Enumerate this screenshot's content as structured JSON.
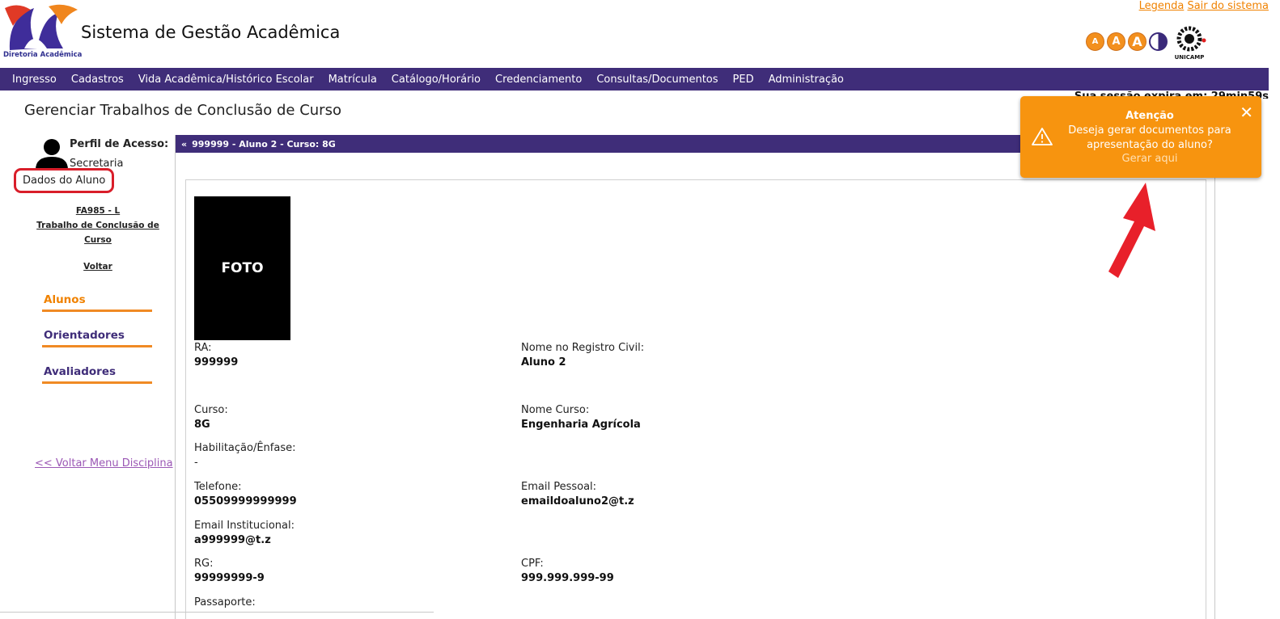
{
  "header": {
    "logo_caption": "Diretoria Acadêmica",
    "system_title": "Sistema de Gestão Acadêmica",
    "links": [
      "Legenda",
      "Sair do sistema"
    ],
    "accessibility": [
      "A",
      "A",
      "A"
    ],
    "unicamp_text": "UNICAMP"
  },
  "nav": {
    "items": [
      "Ingresso",
      "Cadastros",
      "Vida Acadêmica/Histórico Escolar",
      "Matrícula",
      "Catálogo/Horário",
      "Credenciamento",
      "Consultas/Documentos",
      "PED",
      "Administração"
    ]
  },
  "page": {
    "title": "Gerenciar Trabalhos de Conclusão de Curso",
    "partial_text": "Sua sessão expira em: 29min59s"
  },
  "sidebar": {
    "profile_label": "Perfil de Acesso:",
    "profile_value": "Secretaria",
    "course_code": "FA985 - L",
    "course_name_1": "Trabalho de Conclusão de",
    "course_name_2": "Curso",
    "back": "Voltar",
    "menu": [
      "Alunos",
      "Orientadores",
      "Avaliadores"
    ],
    "back_menu": "<< Voltar Menu Disciplina"
  },
  "panel": {
    "header": "999999 - Aluno 2 - Curso: 8G",
    "legend": "Dados do Aluno",
    "photo": "FOTO",
    "fields": {
      "ra_label": "RA:",
      "ra_value": "999999",
      "nome_label": "Nome no Registro Civil:",
      "nome_value": "Aluno 2",
      "curso_label": "Curso:",
      "curso_value": "8G",
      "nome_curso_label": "Nome Curso:",
      "nome_curso_value": "Engenharia Agrícola",
      "hab_label": "Habilitação/Ênfase:",
      "hab_value": "-",
      "tel_label": "Telefone:",
      "tel_value": "05509999999999",
      "email_pessoal_label": "Email Pessoal:",
      "email_pessoal_value": "emaildoaluno2@t.z",
      "email_inst_label": "Email Institucional:",
      "email_inst_value": "a999999@t.z",
      "rg_label": "RG:",
      "rg_value": "99999999-9",
      "cpf_label": "CPF:",
      "cpf_value": "999.999.999-99",
      "passaporte_label": "Passaporte:"
    }
  },
  "toast": {
    "title": "Atenção",
    "message": "Deseja gerar documentos para apresentação do aluno?",
    "link": "Gerar aqui",
    "close": "✕"
  },
  "colors": {
    "nav_bg": "#3f2d79",
    "accent_orange": "#f08200",
    "toast_bg": "#f7940f",
    "highlight_red": "#d91e2a"
  }
}
